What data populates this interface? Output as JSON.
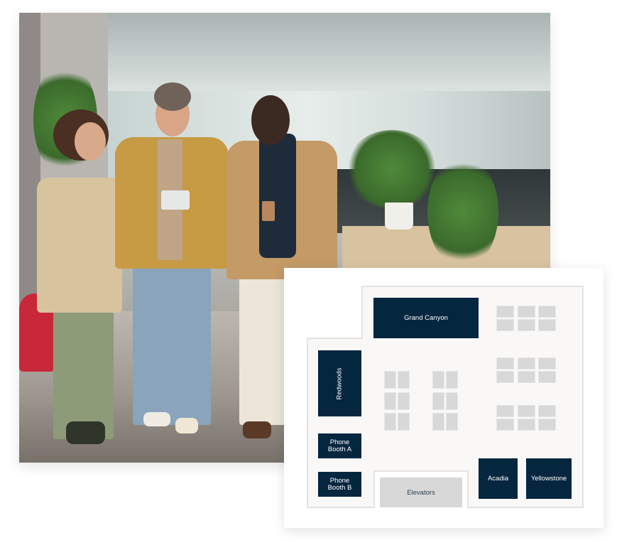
{
  "photo": {
    "description": "Three colleagues walking in an office corridor looking at a tablet"
  },
  "floor_plan": {
    "colors": {
      "room": "#05263f",
      "room_text": "#ffffff",
      "desk": "#d8d8d8",
      "floor": "#f9f8f6",
      "wall": "#d4d4d4",
      "elevators": "#d8d8d8"
    },
    "rooms": {
      "grand_canyon": "Grand Canyon",
      "redwoods": "Redwoods",
      "phone_booth_a": "Phone Booth A",
      "phone_booth_b": "Phone Booth B",
      "acadia": "Acadia",
      "yellowstone": "Yellowstone"
    },
    "elevators": "Elevators",
    "desk_clusters": {
      "vertical_pairs": 2,
      "vertical_rows_per_cluster": 3,
      "horizontal_groups": 3,
      "horizontal_desks_per_group": 6
    }
  }
}
